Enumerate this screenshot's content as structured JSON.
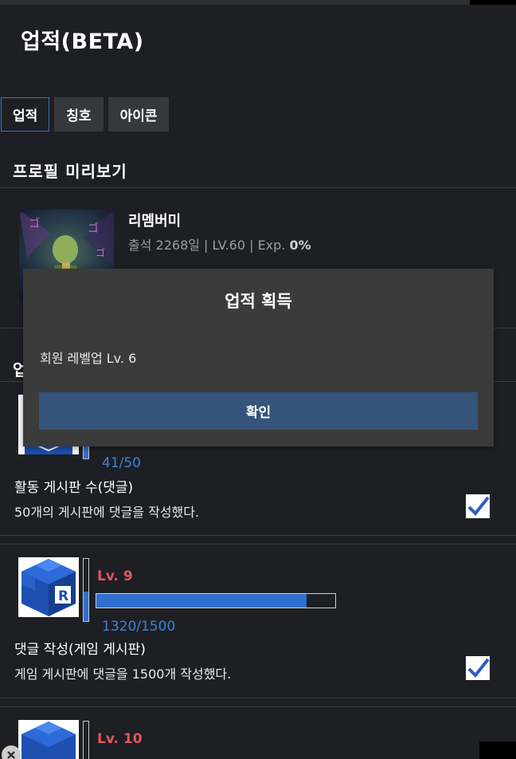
{
  "page": {
    "title": "업적(BETA)"
  },
  "tabs": [
    {
      "label": "업적",
      "active": true
    },
    {
      "label": "칭호",
      "active": false
    },
    {
      "label": "아이콘",
      "active": false
    }
  ],
  "profile": {
    "section_title": "프로필 미리보기",
    "nickname": "리멤버미",
    "attendance": "출석 2268일 | LV.60 | Exp.",
    "exp_percent": "0%"
  },
  "achievements_section": {
    "title": "업"
  },
  "achievements": [
    {
      "progress_text": "41/50",
      "progress_fraction": 0.82,
      "name": "활동 게시판 수(댓글)",
      "description": "50개의 게시판에 댓글을 작성했다.",
      "completed": true
    },
    {
      "level": "Lv. 9",
      "progress_text": "1320/1500",
      "progress_fraction": 0.88,
      "name": "댓글 작성(게임 게시판)",
      "description": "게임 게시판에 댓글을 1500개 작성했다.",
      "completed": true
    },
    {
      "level": "Lv. 10"
    }
  ],
  "modal": {
    "title": "업적 획득",
    "message": "회원 레벨업 Lv. 6",
    "confirm_label": "확인"
  },
  "colors": {
    "accent_blue": "#2e6fd0",
    "level_red": "#e2575b",
    "modal_button": "#36537c"
  }
}
